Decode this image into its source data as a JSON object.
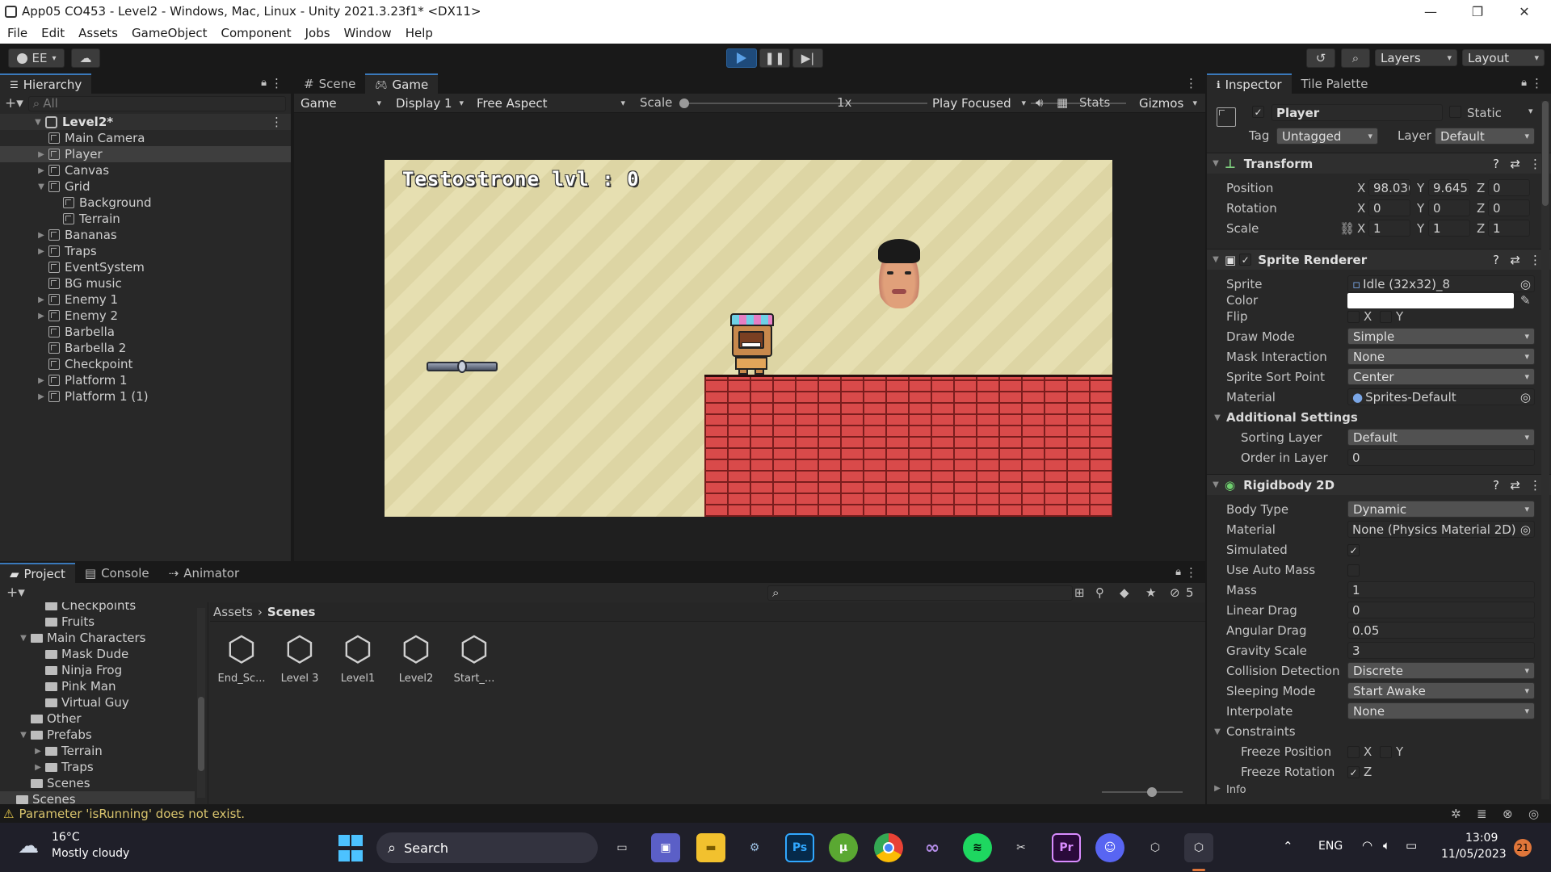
{
  "window": {
    "title": "App05 CO453 - Level2 - Windows, Mac, Linux - Unity 2021.3.23f1* <DX11>"
  },
  "menu": [
    "File",
    "Edit",
    "Assets",
    "GameObject",
    "Component",
    "Jobs",
    "Window",
    "Help"
  ],
  "toolbar": {
    "account": "EE",
    "layers": "Layers",
    "layout": "Layout"
  },
  "hierarchy": {
    "tab": "Hierarchy",
    "search_placeholder": "All",
    "scene": "Level2*",
    "items": [
      {
        "label": "Main Camera",
        "depth": 1,
        "expandable": false
      },
      {
        "label": "Player",
        "depth": 1,
        "expandable": true,
        "selected": true
      },
      {
        "label": "Canvas",
        "depth": 1,
        "expandable": true
      },
      {
        "label": "Grid",
        "depth": 1,
        "expandable": true,
        "expanded": true
      },
      {
        "label": "Background",
        "depth": 2,
        "expandable": false
      },
      {
        "label": "Terrain",
        "depth": 2,
        "expandable": false
      },
      {
        "label": "Bananas",
        "depth": 1,
        "expandable": true
      },
      {
        "label": "Traps",
        "depth": 1,
        "expandable": true
      },
      {
        "label": "EventSystem",
        "depth": 1,
        "expandable": false
      },
      {
        "label": "BG music",
        "depth": 1,
        "expandable": false
      },
      {
        "label": "Enemy 1",
        "depth": 1,
        "expandable": true
      },
      {
        "label": "Enemy 2",
        "depth": 1,
        "expandable": true
      },
      {
        "label": "Barbella",
        "depth": 1,
        "expandable": false
      },
      {
        "label": "Barbella 2",
        "depth": 1,
        "expandable": false
      },
      {
        "label": "Checkpoint",
        "depth": 1,
        "expandable": false
      },
      {
        "label": "Platform 1",
        "depth": 1,
        "expandable": true
      },
      {
        "label": "Platform 1 (1)",
        "depth": 1,
        "expandable": true
      }
    ]
  },
  "view": {
    "tabs": [
      "Scene",
      "Game"
    ],
    "game_dd": "Game",
    "display_dd": "Display 1",
    "aspect_dd": "Free Aspect",
    "scale_label": "Scale",
    "scale_value": "1x",
    "play_focused": "Play Focused",
    "stats": "Stats",
    "gizmos": "Gizmos",
    "hud_text": "Testostrone lvl : 0"
  },
  "inspector": {
    "tabs": [
      "Inspector",
      "Tile Palette"
    ],
    "object_name": "Player",
    "static_label": "Static",
    "tag_label": "Tag",
    "tag_value": "Untagged",
    "layer_label": "Layer",
    "layer_value": "Default",
    "transform": {
      "title": "Transform",
      "rows": [
        {
          "label": "Position",
          "x": "98.036",
          "y": "9.645",
          "z": "0"
        },
        {
          "label": "Rotation",
          "x": "0",
          "y": "0",
          "z": "0"
        },
        {
          "label": "Scale",
          "x": "1",
          "y": "1",
          "z": "1"
        }
      ]
    },
    "sprite_renderer": {
      "title": "Sprite Renderer",
      "sprite_label": "Sprite",
      "sprite_value": "Idle (32x32)_8",
      "color_label": "Color",
      "flip_label": "Flip",
      "draw_mode_label": "Draw Mode",
      "draw_mode_value": "Simple",
      "mask_label": "Mask Interaction",
      "mask_value": "None",
      "sort_point_label": "Sprite Sort Point",
      "sort_point_value": "Center",
      "material_label": "Material",
      "material_value": "Sprites-Default",
      "additional_label": "Additional Settings",
      "sorting_layer_label": "Sorting Layer",
      "sorting_layer_value": "Default",
      "order_label": "Order in Layer",
      "order_value": "0"
    },
    "rigidbody": {
      "title": "Rigidbody 2D",
      "body_type_label": "Body Type",
      "body_type_value": "Dynamic",
      "material_label": "Material",
      "material_value": "None (Physics Material 2D)",
      "simulated_label": "Simulated",
      "auto_mass_label": "Use Auto Mass",
      "mass_label": "Mass",
      "mass_value": "1",
      "linear_drag_label": "Linear Drag",
      "linear_drag_value": "0",
      "angular_drag_label": "Angular Drag",
      "angular_drag_value": "0.05",
      "gravity_label": "Gravity Scale",
      "gravity_value": "3",
      "collision_label": "Collision Detection",
      "collision_value": "Discrete",
      "sleeping_label": "Sleeping Mode",
      "sleeping_value": "Start Awake",
      "interpolate_label": "Interpolate",
      "interpolate_value": "None",
      "constraints_label": "Constraints",
      "freeze_pos_label": "Freeze Position",
      "freeze_rot_label": "Freeze Rotation",
      "info_label": "Info"
    }
  },
  "project": {
    "tabs": [
      "Project",
      "Console",
      "Animator"
    ],
    "hidden_count": "5",
    "breadcrumb_root": "Assets",
    "breadcrumb_current": "Scenes",
    "tree": [
      {
        "label": "Checkpoints",
        "depth": 3,
        "expandable": false
      },
      {
        "label": "Fruits",
        "depth": 3,
        "expandable": false
      },
      {
        "label": "Main Characters",
        "depth": 2,
        "expandable": true
      },
      {
        "label": "Mask Dude",
        "depth": 3,
        "expandable": false
      },
      {
        "label": "Ninja Frog",
        "depth": 3,
        "expandable": false
      },
      {
        "label": "Pink Man",
        "depth": 3,
        "expandable": false
      },
      {
        "label": "Virtual Guy",
        "depth": 3,
        "expandable": false
      },
      {
        "label": "Other",
        "depth": 2,
        "expandable": false
      },
      {
        "label": "Prefabs",
        "depth": 2,
        "expandable": true
      },
      {
        "label": "Terrain",
        "depth": 3,
        "expandable": true
      },
      {
        "label": "Traps",
        "depth": 3,
        "expandable": true
      },
      {
        "label": "Scenes",
        "depth": 2,
        "expandable": false
      },
      {
        "label": "Scenes",
        "depth": 1,
        "expandable": false
      }
    ],
    "assets": [
      "End_Sc...",
      "Level 3",
      "Level1",
      "Level2",
      "Start_..."
    ]
  },
  "status": {
    "message": "Parameter 'isRunning' does not exist."
  },
  "taskbar": {
    "weather_temp": "16°C",
    "weather_desc": "Mostly cloudy",
    "search": "Search",
    "lang": "ENG",
    "time": "13:09",
    "date": "11/05/2023",
    "notifications": "21"
  },
  "colors": {
    "accent": "#3a79bb",
    "play_bg": "#1e4a7a",
    "brick": "#d94a4a",
    "sky": "#e3dcae"
  }
}
